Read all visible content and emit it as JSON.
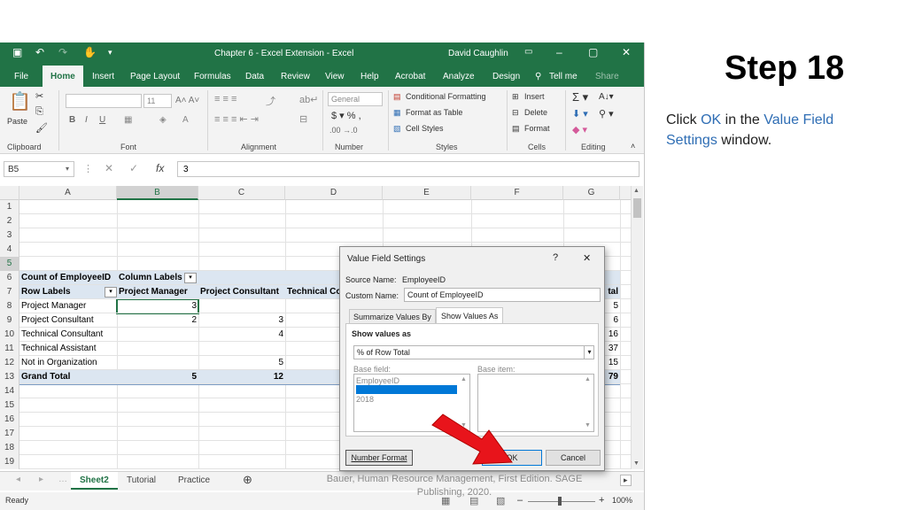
{
  "excel": {
    "quick_access": {
      "save_icon": "save-icon",
      "undo_icon": "undo-icon",
      "redo_icon": "redo-icon"
    },
    "window_title": "Chapter 6 - Excel Extension  -  Excel",
    "user_name": "David Caughlin",
    "tabs": [
      "File",
      "Home",
      "Insert",
      "Page Layout",
      "Formulas",
      "Data",
      "Review",
      "View",
      "Help",
      "Acrobat",
      "Analyze",
      "Design"
    ],
    "tell_me": "Tell me",
    "share": "Share",
    "ribbon": {
      "paste": "Paste",
      "clipboard": "Clipboard",
      "font": "Font",
      "font_size": "11",
      "alignment": "Alignment",
      "number_format": "General",
      "number": "Number",
      "conditional_formatting": "Conditional Formatting",
      "format_as_table": "Format as Table",
      "cell_styles": "Cell Styles",
      "styles": "Styles",
      "insert": "Insert",
      "delete": "Delete",
      "format": "Format",
      "cells": "Cells",
      "editing": "Editing"
    },
    "name_box": "B5",
    "formula": "3",
    "columns": [
      "A",
      "B",
      "C",
      "D",
      "E",
      "F",
      "G"
    ],
    "rows": [
      "1",
      "2",
      "3",
      "4",
      "5",
      "6",
      "7",
      "8",
      "9",
      "10",
      "11",
      "12",
      "13",
      "14",
      "15",
      "16",
      "17",
      "18",
      "19"
    ],
    "pivot": {
      "header_a": "Count of EmployeeID",
      "header_b": "Column Labels",
      "row_labels": "Row Labels",
      "col_headers": [
        "Project Manager",
        "Project Consultant",
        "Technical Co"
      ],
      "total_header": "tal",
      "rows": [
        {
          "label": "Project Manager",
          "b": "3",
          "c": "",
          "g": "5"
        },
        {
          "label": "Project Consultant",
          "b": "2",
          "c": "3",
          "g": "6"
        },
        {
          "label": "Technical Consultant",
          "b": "",
          "c": "4",
          "g": "16"
        },
        {
          "label": "Technical Assistant",
          "b": "",
          "c": "",
          "g": "37"
        },
        {
          "label": "Not in Organization",
          "b": "",
          "c": "5",
          "g": "15"
        }
      ],
      "grand_total": {
        "label": "Grand Total",
        "b": "5",
        "c": "12",
        "g": "79"
      }
    },
    "sheet_tabs": [
      "Sheet2",
      "Tutorial",
      "Practice"
    ],
    "status": "Ready",
    "zoom": "100%"
  },
  "dialog": {
    "title": "Value Field Settings",
    "help": "?",
    "close": "✕",
    "source_name_label": "Source Name:",
    "source_name": "EmployeeID",
    "custom_name_label": "Custom Name:",
    "custom_name": "Count of EmployeeID",
    "tab_summarize": "Summarize Values By",
    "tab_show": "Show Values As",
    "show_values_as_label": "Show values as",
    "show_values_as": "% of Row Total",
    "base_field_label": "Base field:",
    "base_item_label": "Base item:",
    "base_fields": [
      "EmployeeID",
      "",
      "2018"
    ],
    "number_format": "Number Format",
    "ok": "OK",
    "cancel": "Cancel"
  },
  "slide": {
    "step": "Step 18",
    "instr_1": "Click ",
    "instr_ok": "OK",
    "instr_2": " in the ",
    "instr_vfs": "Value Field Settings",
    "instr_3": " window.",
    "footer": "Bauer, Human Resource Management, First Edition. SAGE Publishing, 2020."
  }
}
